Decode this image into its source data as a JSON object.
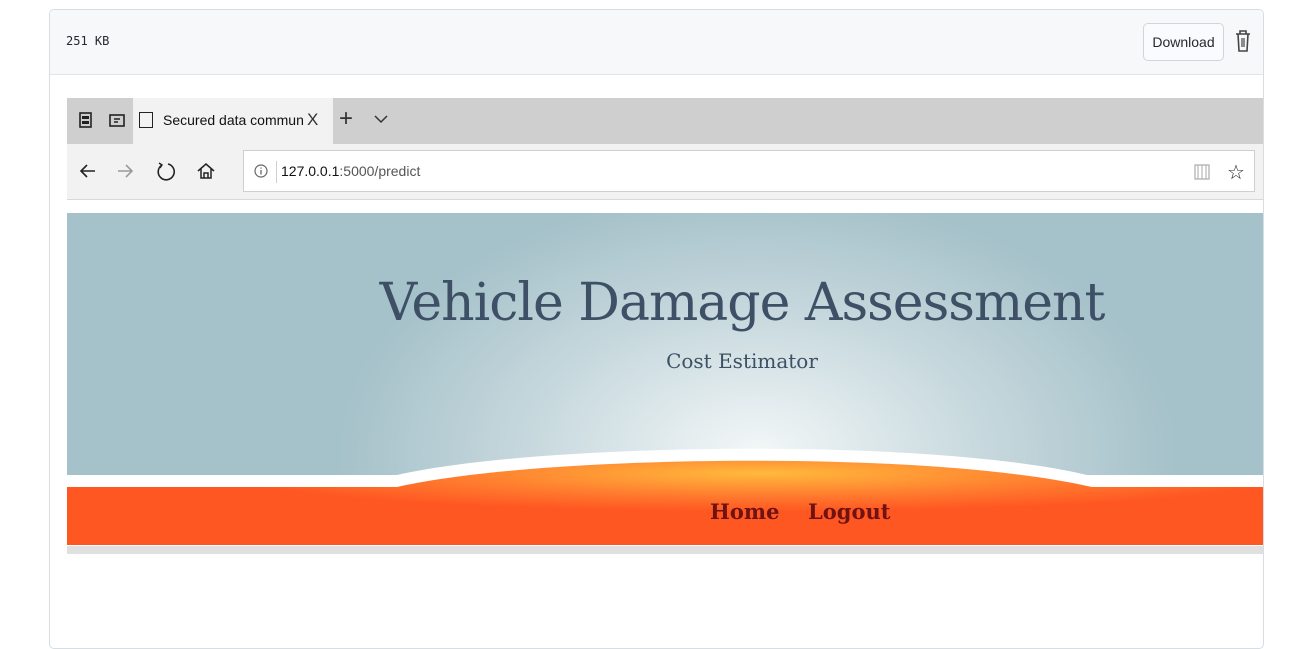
{
  "file_header": {
    "size": "251 KB",
    "download_label": "Download",
    "delete_icon": "trash-icon"
  },
  "browser": {
    "tab_title": "Secured data communication",
    "close_glyph": "X",
    "new_tab_glyph": "+",
    "url_host": "127.0.0.1",
    "url_rest": ":5000/predict",
    "favorite_glyph": "☆"
  },
  "site": {
    "title": "Vehicle Damage Assessment",
    "subtitle": "Cost Estimator",
    "nav": [
      {
        "label": "Home"
      },
      {
        "label": "Logout"
      }
    ],
    "colors": {
      "hero": "#a5c1c9",
      "nav_bar": "#ff5722",
      "nav_glow": "#ffb93d",
      "nav_text": "#6e1212",
      "title_text": "#3d5066"
    }
  }
}
